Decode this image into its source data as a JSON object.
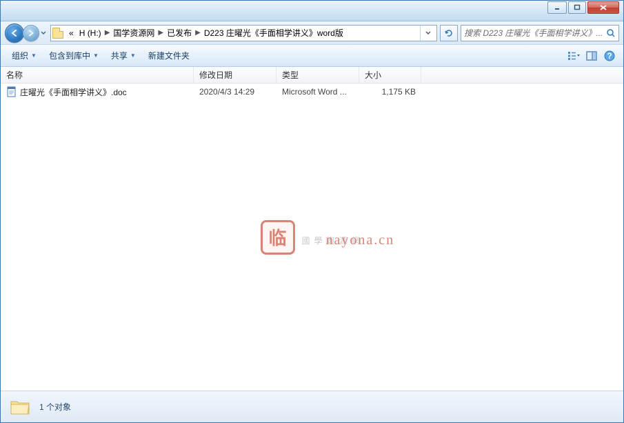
{
  "breadcrumbs": {
    "prefix": "«",
    "items": [
      "H (H:)",
      "国学资源网",
      "已发布",
      "D223 庄曜光《手面相学讲义》word版"
    ]
  },
  "search": {
    "placeholder": "搜索 D223 庄曜光《手面相学讲义》..."
  },
  "toolbar": {
    "organize": "组织",
    "include": "包含到库中",
    "share": "共享",
    "newfolder": "新建文件夹"
  },
  "columns": {
    "name": "名称",
    "date": "修改日期",
    "type": "类型",
    "size": "大小"
  },
  "files": [
    {
      "name": "庄曜光《手面相学讲义》.doc",
      "date": "2020/4/3 14:29",
      "type": "Microsoft Word ...",
      "size": "1,175 KB"
    }
  ],
  "status": {
    "count": "1 个对象"
  },
  "watermark": {
    "stamp": "临",
    "text": "國學資源網",
    "overlay": "nayona.cn"
  }
}
